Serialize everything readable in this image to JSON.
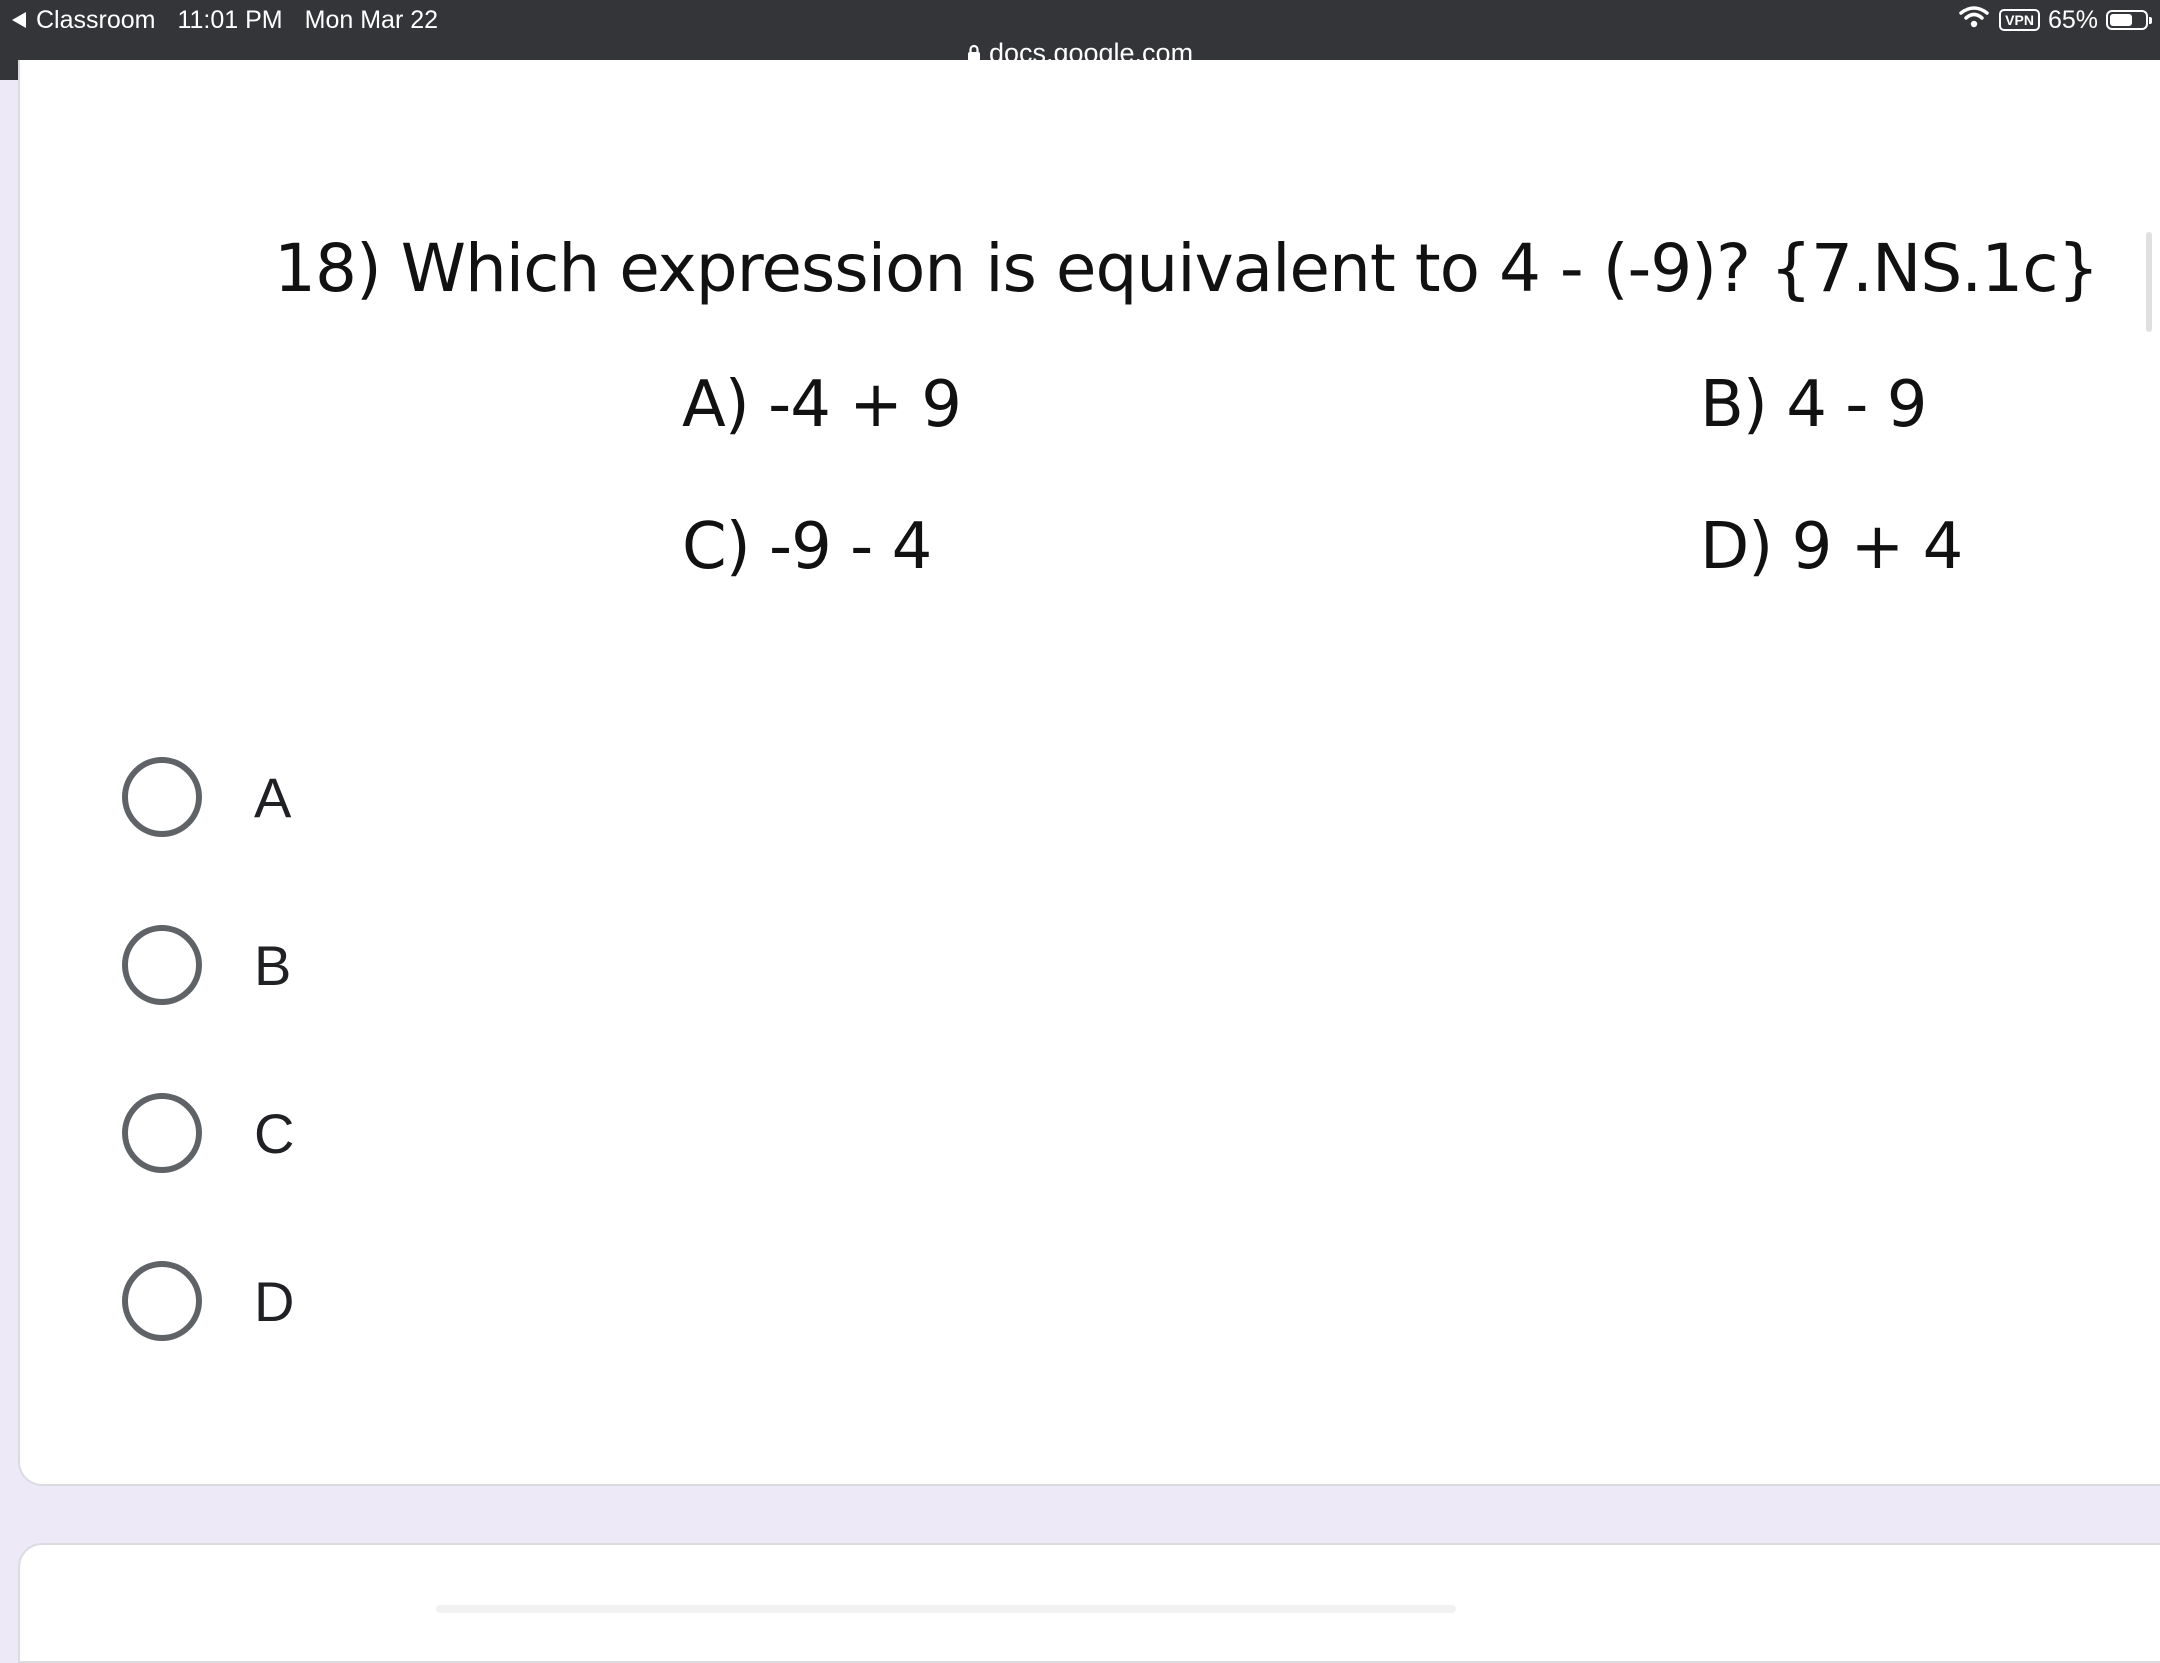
{
  "status_bar": {
    "back_app": "Classroom",
    "time": "11:01 PM",
    "date": "Mon Mar 22",
    "vpn": "VPN",
    "battery": "65%",
    "battery_level": 0.65
  },
  "browser": {
    "url": "docs.google.com"
  },
  "question": {
    "text": "18) Which expression is equivalent to 4 - (-9)? {7.NS.1c}",
    "choices": [
      {
        "text": "A) -4 + 9"
      },
      {
        "text": "B) 4 - 9"
      },
      {
        "text": "C) -9 - 4"
      },
      {
        "text": "D) 9 + 4"
      }
    ]
  },
  "options": [
    {
      "label": "A",
      "selected": false
    },
    {
      "label": "B",
      "selected": false
    },
    {
      "label": "C",
      "selected": false
    },
    {
      "label": "D",
      "selected": false
    }
  ],
  "colors": {
    "status_bar_bg": "#333538",
    "page_bg": "#ede9f7",
    "radio_border": "#5f6368"
  },
  "icons": {
    "back": "back-arrow-icon",
    "wifi": "wifi-icon",
    "battery": "battery-icon",
    "lock": "lock-icon"
  }
}
